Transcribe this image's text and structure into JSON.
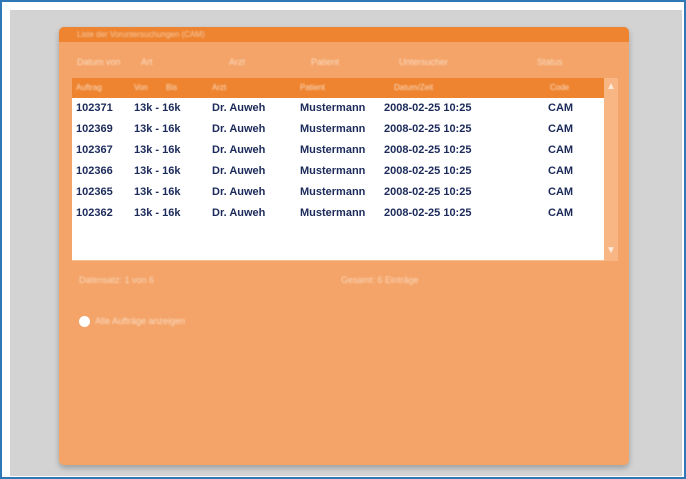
{
  "window": {
    "title": "Liste der Voruntersuchungen (CAM)"
  },
  "filters": [
    "Datum von",
    "Art",
    "Arzt",
    "Patient",
    "Untersucher",
    "Status"
  ],
  "table": {
    "columns": [
      "Auftrag",
      "Von",
      "Bis",
      "Arzt",
      "Patient",
      "Datum/Zeit",
      "Code"
    ],
    "rows": [
      [
        "102371",
        "13k - 16k",
        "Dr. Auweh",
        "Mustermann",
        "2008-02-25 10:25",
        "CAM"
      ],
      [
        "102369",
        "13k - 16k",
        "Dr. Auweh",
        "Mustermann",
        "2008-02-25 10:25",
        "CAM"
      ],
      [
        "102367",
        "13k - 16k",
        "Dr. Auweh",
        "Mustermann",
        "2008-02-25 10:25",
        "CAM"
      ],
      [
        "102366",
        "13k - 16k",
        "Dr. Auweh",
        "Mustermann",
        "2008-02-25 10:25",
        "CAM"
      ],
      [
        "102365",
        "13k - 16k",
        "Dr. Auweh",
        "Mustermann",
        "2008-02-25 10:25",
        "CAM"
      ],
      [
        "102362",
        "13k - 16k",
        "Dr. Auweh",
        "Mustermann",
        "2008-02-25 10:25",
        "CAM"
      ]
    ]
  },
  "info": {
    "left": "Datensatz: 1 von 6",
    "right": "Gesamt: 6 Einträge"
  },
  "option": {
    "label": "Alle Aufträge anzeigen"
  },
  "icons": {
    "scroll_up": "chevron-up-icon",
    "scroll_down": "chevron-down-icon"
  },
  "colors": {
    "frame_border": "#2f78b5",
    "window_bg": "#f4a468",
    "header_bg": "#ee8430",
    "cell_text": "#1b2a5a"
  }
}
